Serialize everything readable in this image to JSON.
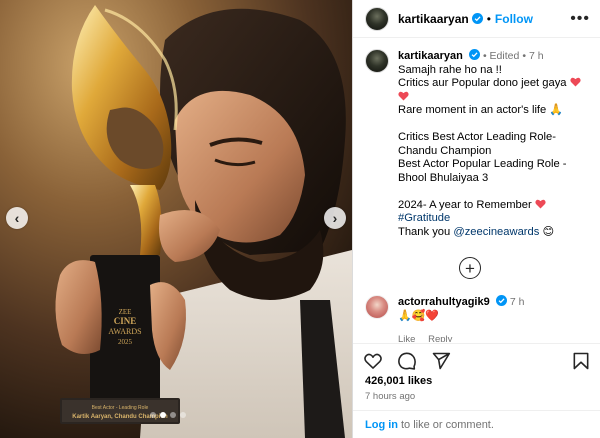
{
  "post": {
    "username": "kartikaaryan",
    "follow_label": "Follow",
    "separator": "•",
    "more_icon": "more-options-icon"
  },
  "media": {
    "description_icon": "trophy-photo",
    "prev_arrow": "‹",
    "next_arrow": "›",
    "dots": 4,
    "active_dot": 2,
    "trophy_text_line1": "ZEE",
    "trophy_text_line2": "CINE",
    "trophy_text_line3": "AWARDS",
    "trophy_text_line4": "2025",
    "trophy_plate_line1": "Best Actor - Leading Role",
    "trophy_plate_line2": "Kartik Aaryan, Chandu Champion"
  },
  "caption": {
    "username": "kartikaaryan",
    "edited": "Edited",
    "time": "7 h",
    "line1": "Samajh rahe ho na !!",
    "line2": "Critics aur Popular dono jeet gaya",
    "line3": "Rare moment in an actor's life 🙏",
    "line4": "Critics Best Actor Leading Role-",
    "line5": "Chandu Champion",
    "line6": "Best Actor Popular Leading Role -",
    "line7": "Bhool Bhulaiyaa 3",
    "line8": "2024- A year to Remember",
    "hashtag": "#Gratitude",
    "thanks_prefix": "Thank you",
    "mention": "@zeecineawards",
    "thanks_suffix": "😊"
  },
  "load_more_label": "+",
  "comment": {
    "username": "actorrahultyagik9",
    "time": "7 h",
    "text": "🙏🥰❤️",
    "like_label": "Like",
    "reply_label": "Reply"
  },
  "actions": {
    "icons": [
      "heart-icon",
      "comment-icon",
      "share-icon",
      "save-icon"
    ]
  },
  "likes_text": "426,001 likes",
  "time_ago": "7 hours ago",
  "login": {
    "link_label": "Log in",
    "suffix": "to like or comment."
  },
  "colors": {
    "accent": "#0095f6",
    "heart": "#ed4956",
    "link": "#00376b",
    "muted": "#737373"
  }
}
